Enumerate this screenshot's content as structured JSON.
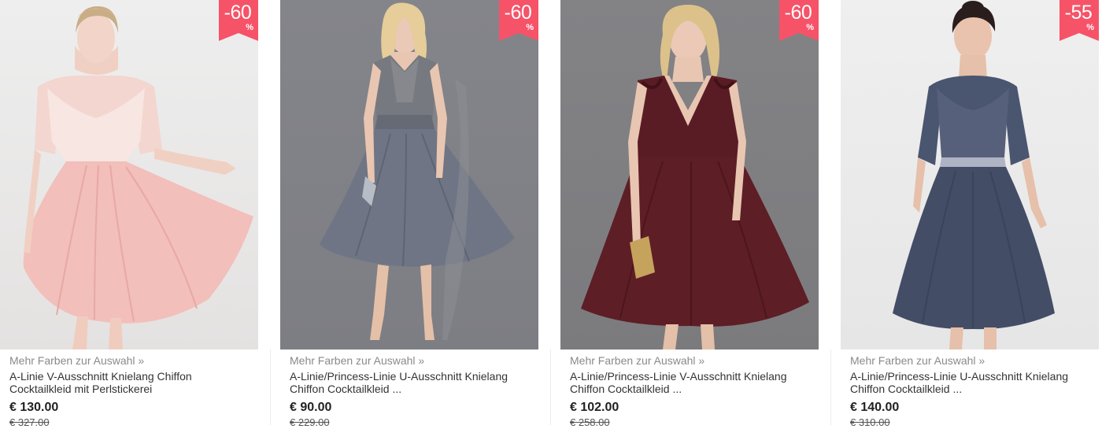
{
  "colors": {
    "badge": "#f65368",
    "pink_dress": "#f2bfbb",
    "steel_dress": "#6f7584",
    "burgundy_dress": "#5e1e26",
    "navy_dress": "#434d66"
  },
  "products": [
    {
      "discount": "-60",
      "discount_unit": "%",
      "more_colors": "Mehr Farben zur Auswahl »",
      "name": "A-Linie V-Ausschnitt Knielang Chiffon Cocktailkleid mit Perlstickerei",
      "price": "€ 130.00",
      "old_price": "€ 327.00",
      "image_icon": "pink-lace-dress-photo"
    },
    {
      "discount": "-60",
      "discount_unit": "%",
      "more_colors": "Mehr Farben zur Auswahl »",
      "name": "A-Linie/Princess-Linie U-Ausschnitt Knielang Chiffon Cocktailkleid ...",
      "price": "€ 90.00",
      "old_price": "€ 229.00",
      "image_icon": "steel-grey-halter-dress-photo"
    },
    {
      "discount": "-60",
      "discount_unit": "%",
      "more_colors": "Mehr Farben zur Auswahl »",
      "name": "A-Linie/Princess-Linie V-Ausschnitt Knielang Chiffon Cocktailkleid ...",
      "price": "€ 102.00",
      "old_price": "€ 258.00",
      "image_icon": "burgundy-v-neck-dress-photo"
    },
    {
      "discount": "-55",
      "discount_unit": "%",
      "more_colors": "Mehr Farben zur Auswahl »",
      "name": "A-Linie/Princess-Linie U-Ausschnitt Knielang Chiffon Cocktailkleid ...",
      "price": "€ 140.00",
      "old_price": "€ 310.00",
      "image_icon": "navy-lace-dress-photo"
    }
  ]
}
